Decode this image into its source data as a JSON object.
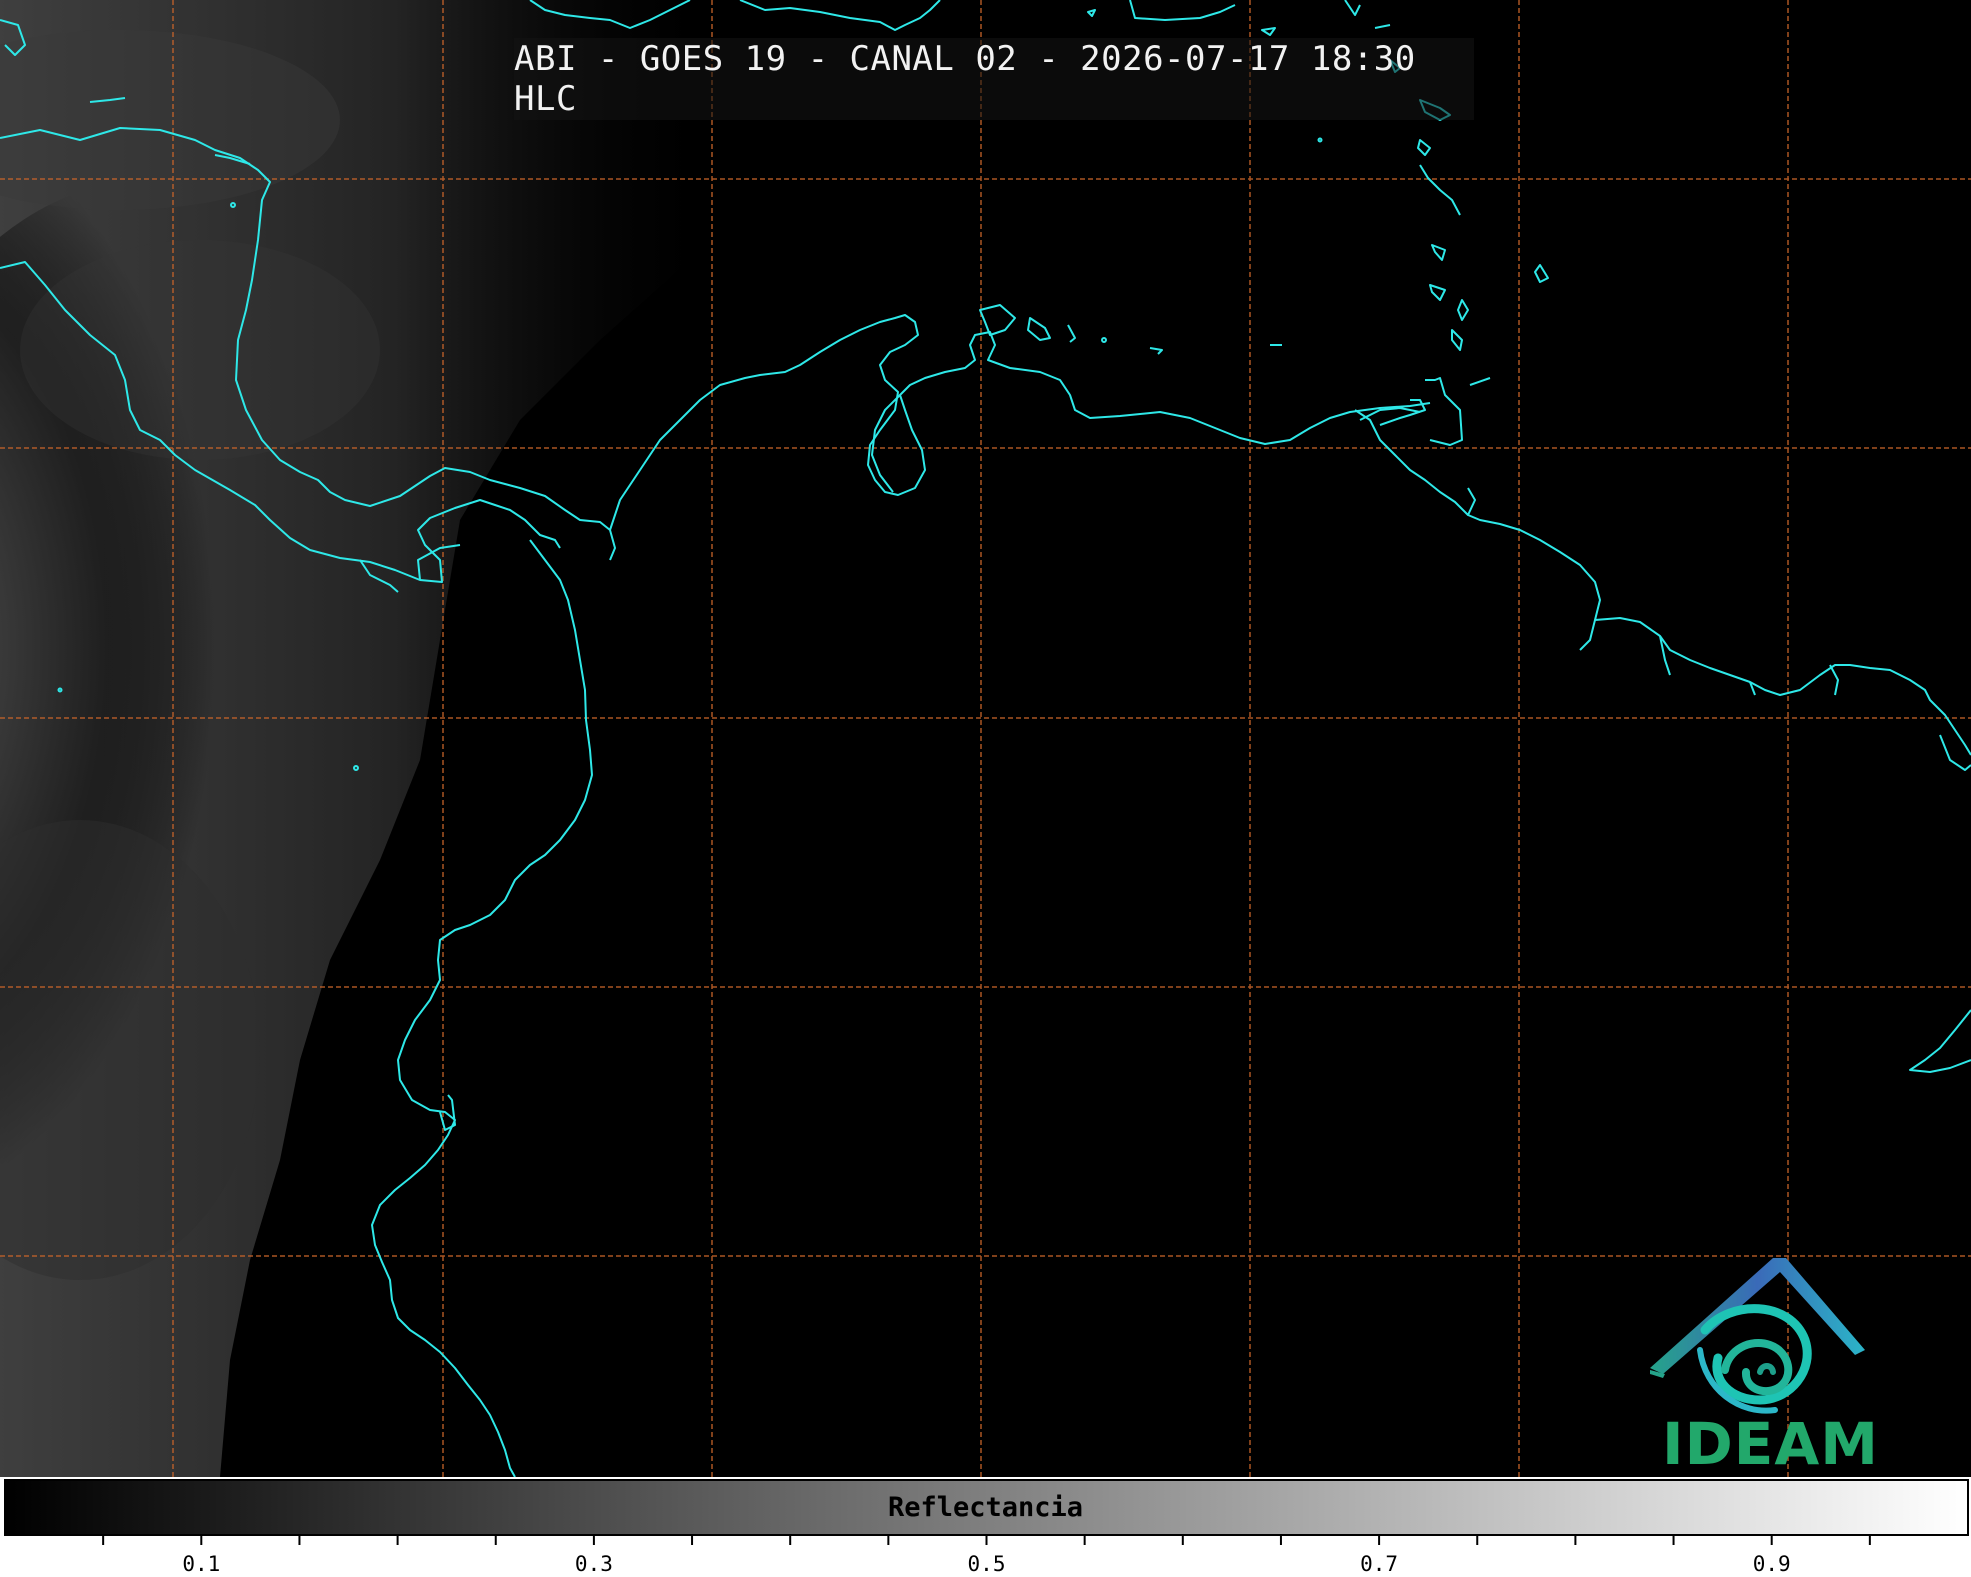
{
  "title": "ABI - GOES 19 - CANAL 02 - 2026-07-17 18:30 HLC",
  "logo": {
    "name": "IDEAM",
    "colors": [
      "#3a6ab8",
      "#22b5a0",
      "#22a86b"
    ]
  },
  "colorbar": {
    "label": "Reflectancia",
    "range": [
      0.0,
      1.0
    ],
    "tick_labels": [
      {
        "text": "0.1",
        "value": 0.1
      },
      {
        "text": "0.3",
        "value": 0.3
      },
      {
        "text": "0.5",
        "value": 0.5
      },
      {
        "text": "0.7",
        "value": 0.7
      },
      {
        "text": "0.9",
        "value": 0.9
      }
    ],
    "minor_tick_step": 0.05,
    "colormap": "grayscale black-to-white"
  },
  "map": {
    "type": "satellite visible reflectance",
    "coastline_color": "#2ee8e8",
    "grid_color": "#c8642a",
    "grid_style": "dashed"
  }
}
